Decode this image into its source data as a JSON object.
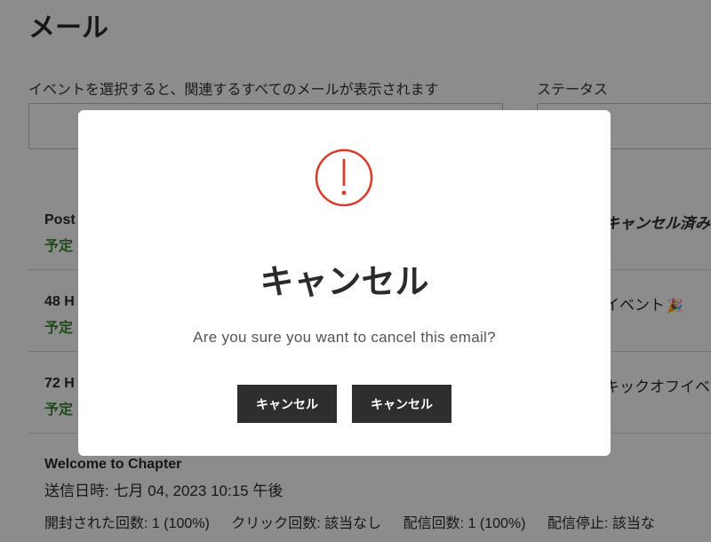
{
  "page": {
    "title": "メール"
  },
  "filters": {
    "event_label": "イベントを選択すると、関連するすべてのメールが表示されます",
    "event_value": "",
    "status_label": "ステータス",
    "status_value": ""
  },
  "emails": [
    {
      "title": "Post",
      "status": "予定",
      "right_text": "キャンセル済み"
    },
    {
      "title": "48 H",
      "status": "予定",
      "right_text": "イベント"
    },
    {
      "title": "72 H",
      "status": "予定",
      "right_text": "キックオフイベ"
    }
  ],
  "sent_email": {
    "title": "Welcome to Chapter",
    "sent_at": "送信日時: 七月 04, 2023 10:15 午後",
    "stats": {
      "opened": "開封された回数: 1 (100%)",
      "clicks": "クリック回数: 該当なし",
      "deliveries": "配信回数: 1 (100%)",
      "unsubscribe": "配信停止: 該当な"
    }
  },
  "modal": {
    "icon": "alert-circle-icon",
    "icon_color": "#d93a2b",
    "title": "キャンセル",
    "message": "Are you sure you want to cancel this email?",
    "buttons": [
      {
        "label": "キャンセル"
      },
      {
        "label": "キャンセル"
      }
    ]
  },
  "colors": {
    "scheduled_status": "#3f8a36",
    "button_bg": "#2e2e2e"
  }
}
